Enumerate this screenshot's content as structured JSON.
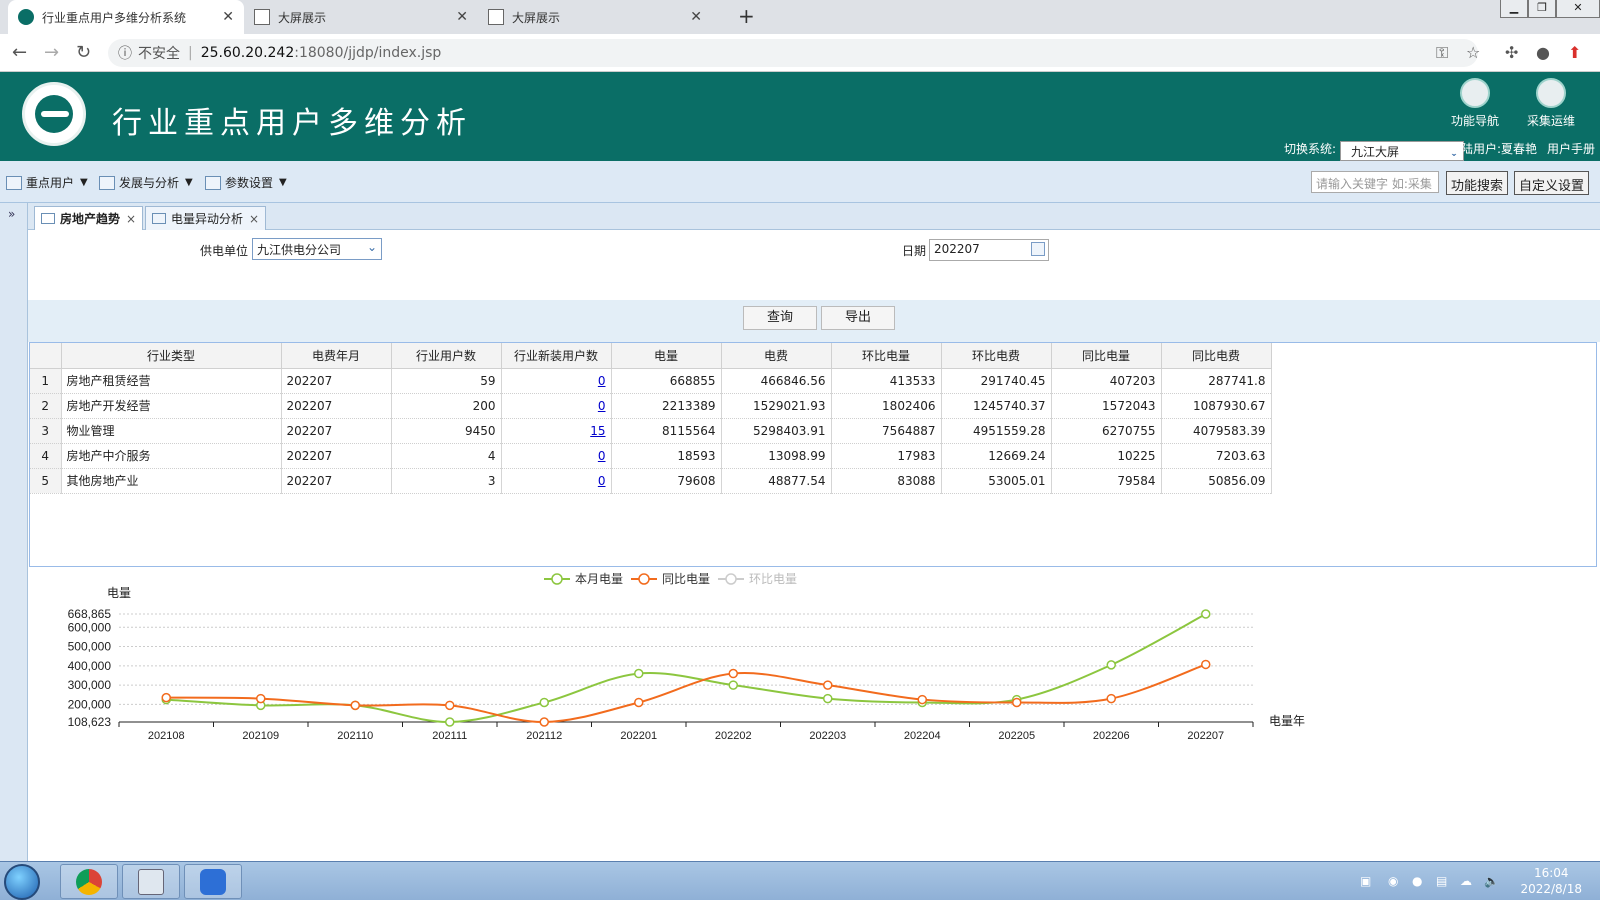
{
  "browser": {
    "tabs": [
      {
        "title": "行业重点用户多维分析系统",
        "active": true
      },
      {
        "title": "大屏展示",
        "active": false
      },
      {
        "title": "大屏展示",
        "active": false
      }
    ],
    "new_tab": "+",
    "security_label": "不安全",
    "url_host": "25.60.20.242",
    "url_rest": ":18080/jjdp/index.jsp"
  },
  "app": {
    "title": "行业重点用户多维分析",
    "nav_button": "功能导航",
    "ops_button": "采集运维",
    "switch_label": "切换系统:",
    "switch_value": "九江大屏",
    "login_user": "登陆用户:夏春艳",
    "user_manual": "用户手册"
  },
  "menu": {
    "items": [
      "重点用户",
      "发展与分析",
      "参数设置"
    ],
    "search_placeholder": "请输入关键字 如:采集",
    "search_button": "功能搜索",
    "custom_button": "自定义设置"
  },
  "tabs": [
    {
      "label": "房地产趋势",
      "active": true
    },
    {
      "label": "电量异动分析",
      "active": false
    }
  ],
  "filters": {
    "unit_label": "供电单位",
    "unit_value": "九江供电分公司",
    "date_label": "日期",
    "date_value": "202207",
    "query_button": "查询",
    "export_button": "导出"
  },
  "table": {
    "columns": [
      "行业类型",
      "电费年月",
      "行业用户数",
      "行业新装用户数",
      "电量",
      "电费",
      "环比电量",
      "环比电费",
      "同比电量",
      "同比电费"
    ],
    "rows": [
      [
        "1",
        "房地产租赁经营",
        "202207",
        "59",
        "0",
        "668855",
        "466846.56",
        "413533",
        "291740.45",
        "407203",
        "287741.8"
      ],
      [
        "2",
        "房地产开发经营",
        "202207",
        "200",
        "0",
        "2213389",
        "1529021.93",
        "1802406",
        "1245740.37",
        "1572043",
        "1087930.67"
      ],
      [
        "3",
        "物业管理",
        "202207",
        "9450",
        "15",
        "8115564",
        "5298403.91",
        "7564887",
        "4951559.28",
        "6270755",
        "4079583.39"
      ],
      [
        "4",
        "房地产中介服务",
        "202207",
        "4",
        "0",
        "18593",
        "13098.99",
        "17983",
        "12669.24",
        "10225",
        "7203.63"
      ],
      [
        "5",
        "其他房地产业",
        "202207",
        "3",
        "0",
        "79608",
        "48877.54",
        "83088",
        "53005.01",
        "79584",
        "50856.09"
      ]
    ]
  },
  "chart_data": {
    "type": "line",
    "title": "",
    "xlabel": "电量年",
    "ylabel": "电量",
    "x": [
      "202108",
      "202109",
      "202110",
      "202111",
      "202112",
      "202201",
      "202202",
      "202203",
      "202204",
      "202205",
      "202206",
      "202207"
    ],
    "y_ticks": [
      "668,865",
      "600,000",
      "500,000",
      "400,000",
      "300,000",
      "200,000",
      "108,623"
    ],
    "ylim": [
      108623,
      668865
    ],
    "legend_position": "top-center",
    "series": [
      {
        "name": "本月电量",
        "color": "#8cc63f",
        "visible": true,
        "values": [
          225000,
          195000,
          195000,
          108623,
          210000,
          360000,
          300000,
          230000,
          210000,
          225000,
          405000,
          668865
        ]
      },
      {
        "name": "同比电量",
        "color": "#f26b1d",
        "visible": true,
        "values": [
          235000,
          230000,
          195000,
          195000,
          108623,
          210000,
          360000,
          300000,
          225000,
          210000,
          230000,
          407203
        ]
      },
      {
        "name": "环比电量",
        "color": "#cccccc",
        "visible": false,
        "values": []
      }
    ]
  },
  "taskbar": {
    "time": "16:04",
    "date": "2022/8/18"
  }
}
